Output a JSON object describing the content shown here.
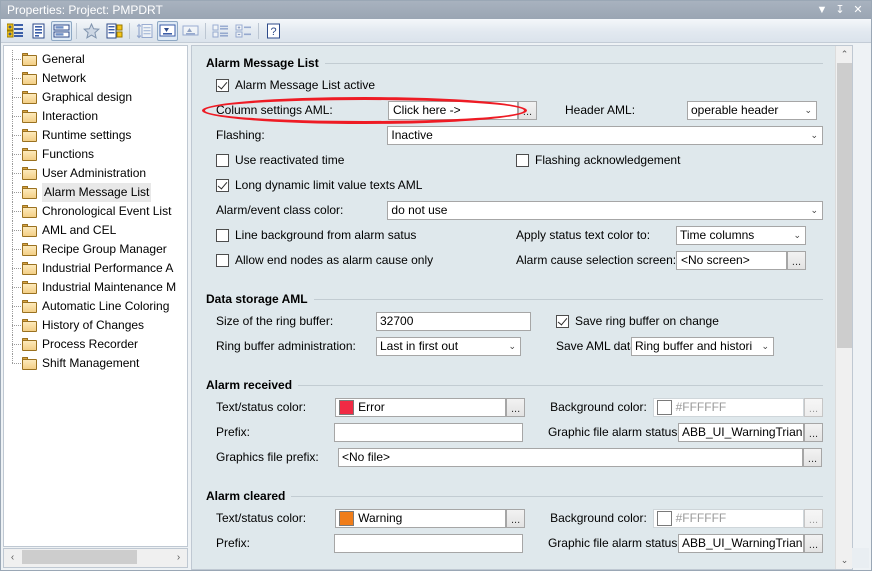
{
  "window": {
    "title": "Properties: Project: PMPDRT",
    "buttons": [
      {
        "name": "menu-dropdown-button",
        "glyph": "▼"
      },
      {
        "name": "pin-button",
        "glyph": "↧"
      },
      {
        "name": "close-button",
        "glyph": "✕"
      }
    ]
  },
  "toolbar": {
    "items": [
      {
        "name": "new-object-button",
        "icon": "new-object-icon",
        "state": "normal"
      },
      {
        "name": "properties-button",
        "icon": "document-properties-icon",
        "state": "normal"
      },
      {
        "name": "split-view-button",
        "icon": "split-view-icon",
        "state": "pressed"
      },
      {
        "name": "favorites-button",
        "icon": "star-icon",
        "state": "normal"
      },
      {
        "name": "list-details-button",
        "icon": "list-details-icon",
        "state": "normal"
      },
      {
        "name": "sort-by-height-button",
        "icon": "sort-vertical-icon",
        "state": "disabled"
      },
      {
        "name": "align-bottom-button",
        "icon": "align-bottom-icon",
        "state": "pressed"
      },
      {
        "name": "align-top-button",
        "icon": "align-top-icon",
        "state": "disabled"
      },
      {
        "name": "group-list-button",
        "icon": "group-list-icon",
        "state": "disabled"
      },
      {
        "name": "expand-collapse-button",
        "icon": "expand-collapse-icon",
        "state": "disabled"
      },
      {
        "name": "help-button",
        "icon": "help-question-icon",
        "state": "normal"
      }
    ]
  },
  "tree": {
    "items": [
      {
        "label": "General",
        "selected": false
      },
      {
        "label": "Network",
        "selected": false
      },
      {
        "label": "Graphical design",
        "selected": false
      },
      {
        "label": "Interaction",
        "selected": false
      },
      {
        "label": "Runtime settings",
        "selected": false
      },
      {
        "label": "Functions",
        "selected": false
      },
      {
        "label": "User Administration",
        "selected": false
      },
      {
        "label": "Alarm Message List",
        "selected": true
      },
      {
        "label": "Chronological Event List",
        "selected": false
      },
      {
        "label": "AML and CEL",
        "selected": false
      },
      {
        "label": "Recipe Group Manager",
        "selected": false
      },
      {
        "label": "Industrial Performance A",
        "selected": false
      },
      {
        "label": "Industrial Maintenance M",
        "selected": false
      },
      {
        "label": "Automatic Line Coloring",
        "selected": false
      },
      {
        "label": "History of Changes",
        "selected": false
      },
      {
        "label": "Process Recorder",
        "selected": false
      },
      {
        "label": "Shift Management",
        "selected": false
      }
    ]
  },
  "groups": {
    "alarm_message_list": {
      "title": "Alarm Message List",
      "active_checkbox": {
        "label": "Alarm Message List active",
        "checked": true
      },
      "column_settings_label": "Column settings AML:",
      "column_settings_value": "Click here ->",
      "header_aml_label": "Header AML:",
      "header_aml_value": "operable header",
      "flashing_label": "Flashing:",
      "flashing_value": "Inactive",
      "use_reactivated_time": {
        "label": "Use reactivated time",
        "checked": false
      },
      "flashing_acknowledgement": {
        "label": "Flashing acknowledgement",
        "checked": false
      },
      "long_dynamic_limit": {
        "label": "Long dynamic limit value texts AML",
        "checked": true
      },
      "alarm_event_class_color_label": "Alarm/event class color:",
      "alarm_event_class_color_value": "do not use",
      "line_background": {
        "label": "Line background from alarm satus",
        "checked": false
      },
      "allow_end_nodes": {
        "label": "Allow end nodes as alarm cause only",
        "checked": false
      },
      "apply_status_text_label": "Apply status text color to:",
      "apply_status_text_value": "Time columns",
      "alarm_cause_screen_label": "Alarm cause selection screen:",
      "alarm_cause_screen_value": "<No screen>"
    },
    "data_storage_aml": {
      "title": "Data storage AML",
      "ring_buffer_size_label": "Size of the ring buffer:",
      "ring_buffer_size_value": "32700",
      "save_ring_buffer": {
        "label": "Save ring buffer on change",
        "checked": true
      },
      "ring_buffer_admin_label": "Ring buffer administration:",
      "ring_buffer_admin_value": "Last in first out",
      "save_aml_data_label": "Save AML data:",
      "save_aml_data_value": "Ring buffer and histori"
    },
    "alarm_received": {
      "title": "Alarm received",
      "text_status_color_label": "Text/status color:",
      "text_status_color_value": "Error",
      "text_status_color_swatch": "#f02a44",
      "background_color_label": "Background color:",
      "background_color_value": "#FFFFFF",
      "background_color_swatch": "#ffffff",
      "prefix_label": "Prefix:",
      "prefix_value": "",
      "graphic_file_alarm_status_label": "Graphic file alarm status:",
      "graphic_file_alarm_status_value": "ABB_UI_WarningTriangle_",
      "graphics_file_prefix_label": "Graphics file prefix:",
      "graphics_file_prefix_value": "<No file>",
      "graphics_file_prefix_right_value": ""
    },
    "alarm_cleared": {
      "title": "Alarm cleared",
      "text_status_color_label": "Text/status color:",
      "text_status_color_value": "Warning",
      "text_status_color_swatch": "#f07d1a",
      "background_color_label": "Background color:",
      "background_color_value": "#FFFFFF",
      "background_color_swatch": "#ffffff",
      "prefix_label": "Prefix:",
      "prefix_value": "",
      "graphic_file_alarm_status_label": "Graphic file alarm status:",
      "graphic_file_alarm_status_value": "ABB_UI_WarningTriangle_"
    }
  },
  "scrollbars": {
    "vertical_up": "⌃",
    "vertical_down": "⌄",
    "horizontal_left": "‹",
    "horizontal_right": "›"
  },
  "icons": {
    "chevron_down": "⌄",
    "ellipsis": "..."
  },
  "colors": {
    "highlight_ellipse": "#ee1b24",
    "panel_background": "#dfe8ec",
    "titlebar": "#9aa5b3"
  }
}
